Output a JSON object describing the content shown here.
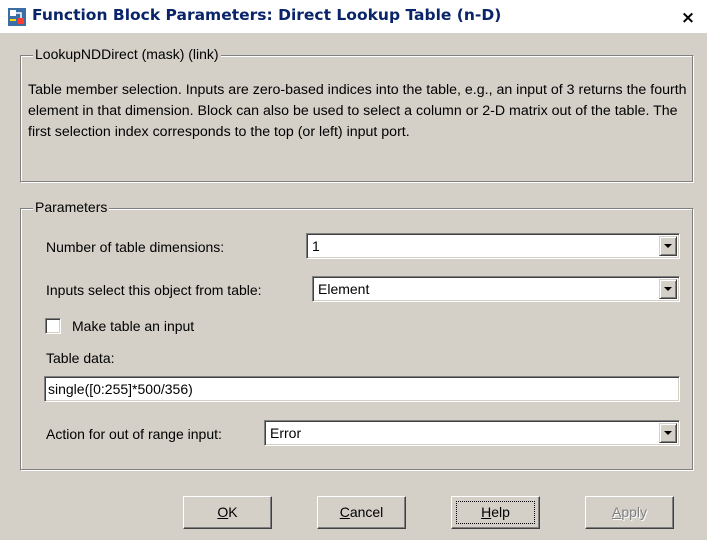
{
  "window": {
    "title": "Function Block Parameters: Direct Lookup Table (n-D)",
    "close_glyph": "×"
  },
  "description_group": {
    "legend": "LookupNDDirect (mask) (link)",
    "text": "Table member selection.  Inputs are zero-based indices into the table, e.g., an input of 3 returns the fourth element in that dimension.  Block can also be used to select a column or 2-D matrix out of the table.  The first selection index corresponds to the top (or left) input port."
  },
  "parameters_group": {
    "legend": "Parameters",
    "num_dimensions": {
      "label": "Number of table dimensions:",
      "value": "1"
    },
    "select_object": {
      "label": "Inputs select this object from table:",
      "value": "Element"
    },
    "make_table_input": {
      "label": "Make table an input",
      "checked": false
    },
    "table_data": {
      "label": "Table data:",
      "value": "single([0:255]*500/356)"
    },
    "out_of_range": {
      "label": "Action for out of range input:",
      "value": "Error"
    }
  },
  "buttons": {
    "ok": {
      "mnemonic": "O",
      "rest": "K"
    },
    "cancel": {
      "mnemonic": "C",
      "rest": "ancel"
    },
    "help": {
      "mnemonic": "H",
      "rest": "elp"
    },
    "apply": {
      "mnemonic": "A",
      "rest": "pply",
      "enabled": false
    }
  },
  "icons": {
    "title_icon": "simulink-block-icon",
    "close": "close-icon",
    "dropdown": "chevron-down-icon"
  },
  "colors": {
    "dialog_bg": "#d4d0c8",
    "title_text": "#0a246a",
    "disabled_text": "#808080"
  }
}
